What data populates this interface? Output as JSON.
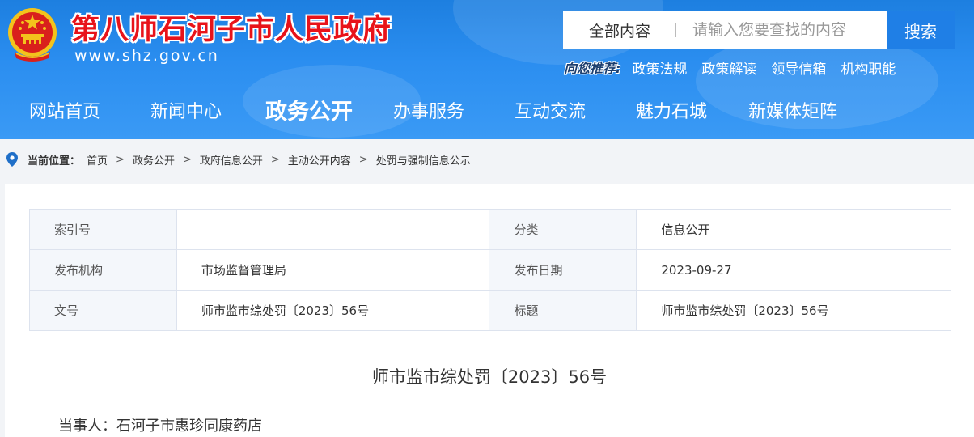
{
  "header": {
    "site_title": "第八师石河子市人民政府",
    "site_url": "www.shz.gov.cn"
  },
  "search": {
    "scope": "全部内容",
    "placeholder": "请输入您要查找的内容",
    "button": "搜索"
  },
  "recommend": {
    "label": "向您推荐:",
    "links": [
      "政策法规",
      "政策解读",
      "领导信箱",
      "机构职能"
    ]
  },
  "nav": {
    "items": [
      "网站首页",
      "新闻中心",
      "政务公开",
      "办事服务",
      "互动交流",
      "魅力石城",
      "新媒体矩阵"
    ],
    "active": "政务公开"
  },
  "breadcrumb": {
    "label": "当前位置：",
    "items": [
      "首页",
      "政务公开",
      "政府信息公开",
      "主动公开内容",
      "处罚与强制信息公示"
    ]
  },
  "meta": {
    "rows": [
      [
        "索引号",
        "",
        "分类",
        "信息公开"
      ],
      [
        "发布机构",
        "市场监督管理局",
        "发布日期",
        "2023-09-27"
      ],
      [
        "文号",
        "师市监市综处罚〔2023〕56号",
        "标题",
        "师市监市综处罚〔2023〕56号"
      ]
    ]
  },
  "article": {
    "title": "师市监市综处罚〔2023〕56号",
    "party": "当事人：石河子市惠珍同康药店"
  },
  "colors": {
    "header_blue": "#2b8ef0",
    "title_red": "#e8131a",
    "search_button": "#1f7fe6"
  }
}
